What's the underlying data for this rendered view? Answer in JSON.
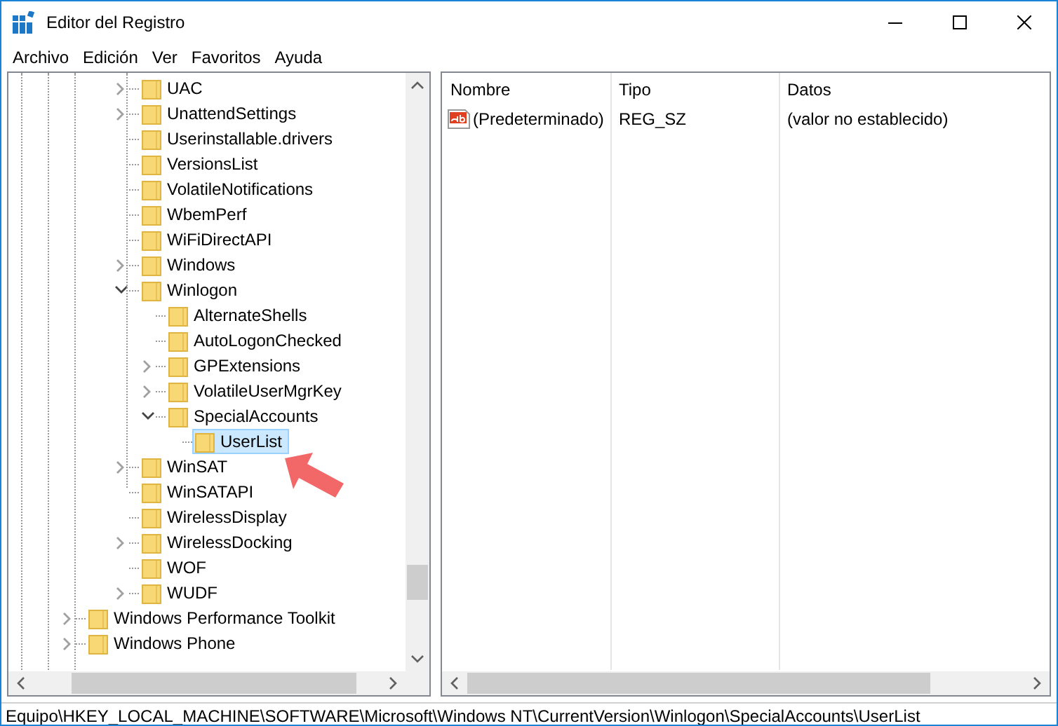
{
  "window": {
    "title": "Editor del Registro"
  },
  "menu": [
    "Archivo",
    "Edición",
    "Ver",
    "Favoritos",
    "Ayuda"
  ],
  "tree": {
    "items": [
      {
        "children": [
          {
            "children": [
              {
                "label": "UAC",
                "expandable": true,
                "expanded": false,
                "selected": false
              },
              {
                "label": "UnattendSettings",
                "expandable": true,
                "expanded": false,
                "selected": false
              },
              {
                "label": "Userinstallable.drivers",
                "expandable": false,
                "selected": false
              },
              {
                "label": "VersionsList",
                "expandable": false,
                "selected": false
              },
              {
                "label": "VolatileNotifications",
                "expandable": false,
                "selected": false
              },
              {
                "label": "WbemPerf",
                "expandable": false,
                "selected": false
              },
              {
                "label": "WiFiDirectAPI",
                "expandable": false,
                "selected": false
              },
              {
                "label": "Windows",
                "expandable": true,
                "expanded": false,
                "selected": false
              },
              {
                "label": "Winlogon",
                "expandable": true,
                "expanded": true,
                "selected": false,
                "children": [
                  {
                    "label": "AlternateShells",
                    "expandable": false,
                    "selected": false
                  },
                  {
                    "label": "AutoLogonChecked",
                    "expandable": false,
                    "selected": false
                  },
                  {
                    "label": "GPExtensions",
                    "expandable": true,
                    "expanded": false,
                    "selected": false
                  },
                  {
                    "label": "VolatileUserMgrKey",
                    "expandable": true,
                    "expanded": false,
                    "selected": false
                  },
                  {
                    "label": "SpecialAccounts",
                    "expandable": true,
                    "expanded": true,
                    "selected": false,
                    "children": [
                      {
                        "label": "UserList",
                        "expandable": false,
                        "selected": true
                      }
                    ]
                  }
                ]
              },
              {
                "label": "WinSAT",
                "expandable": true,
                "expanded": false,
                "selected": false
              },
              {
                "label": "WinSATAPI",
                "expandable": false,
                "selected": false
              },
              {
                "label": "WirelessDisplay",
                "expandable": false,
                "selected": false
              },
              {
                "label": "WirelessDocking",
                "expandable": true,
                "expanded": false,
                "selected": false
              },
              {
                "label": "WOF",
                "expandable": false,
                "selected": false
              },
              {
                "label": "WUDF",
                "expandable": true,
                "expanded": false,
                "selected": false
              }
            ]
          }
        ]
      },
      {
        "label": "Windows Performance Toolkit",
        "expandable": true,
        "expanded": false,
        "selected": false
      },
      {
        "label": "Windows Phone",
        "expandable": true,
        "expanded": false,
        "selected": false
      }
    ]
  },
  "values": {
    "columns": [
      "Nombre",
      "Tipo",
      "Datos"
    ],
    "rows": [
      {
        "kind": "string",
        "name": "(Predeterminado)",
        "type": "REG_SZ",
        "data": "(valor no establecido)"
      }
    ]
  },
  "status_bar": "Equipo\\HKEY_LOCAL_MACHINE\\SOFTWARE\\Microsoft\\Windows NT\\CurrentVersion\\Winlogon\\SpecialAccounts\\UserList"
}
